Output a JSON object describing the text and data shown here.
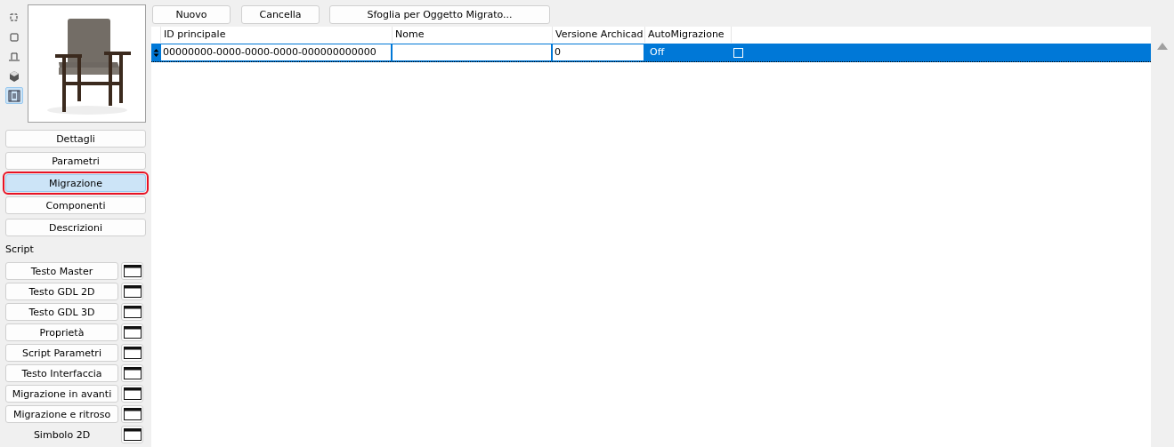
{
  "view_icons": [
    {
      "kind": "plan-outline",
      "selected": false
    },
    {
      "kind": "square",
      "selected": false
    },
    {
      "kind": "elevation",
      "selected": false
    },
    {
      "kind": "cube",
      "selected": false
    },
    {
      "kind": "film-list",
      "selected": true
    }
  ],
  "preview": {
    "kind": "picture"
  },
  "sections": [
    {
      "label": "Dettagli",
      "selected": false
    },
    {
      "label": "Parametri",
      "selected": false
    },
    {
      "label": "Migrazione",
      "selected": true
    },
    {
      "label": "Componenti",
      "selected": false
    },
    {
      "label": "Descrizioni",
      "selected": false
    }
  ],
  "script_heading": "Script",
  "scripts": [
    {
      "label": "Testo Master",
      "framed": true
    },
    {
      "label": "Testo GDL 2D",
      "framed": true
    },
    {
      "label": "Testo GDL 3D",
      "framed": true
    },
    {
      "label": "Proprietà",
      "framed": true
    },
    {
      "label": "Script Parametri",
      "framed": true
    },
    {
      "label": "Testo Interfaccia",
      "framed": true
    },
    {
      "label": "Migrazione in avanti",
      "framed": true
    },
    {
      "label": "Migrazione e ritroso",
      "framed": true
    },
    {
      "label": "Simbolo 2D",
      "framed": false
    }
  ],
  "toolbar": [
    "Nuovo",
    "Cancella",
    "Sfoglia per Oggetto Migrato..."
  ],
  "table": {
    "columns": [
      "ID principale",
      "Nome",
      "Versione Archicad",
      "AutoMigrazione"
    ],
    "rows": [
      {
        "selected": true,
        "id": "00000000-0000-0000-0000-000000000000",
        "name": "",
        "version": "0",
        "auto": "Off",
        "checked": false
      }
    ]
  }
}
